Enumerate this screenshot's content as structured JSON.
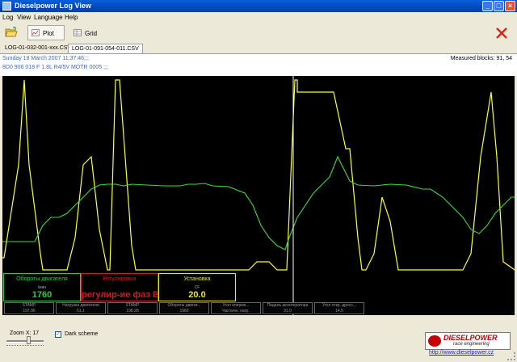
{
  "window": {
    "title": "Dieselpower Log View"
  },
  "menu": [
    "Log",
    "View",
    "Language",
    "Help"
  ],
  "toolbar": {
    "plot_label": "Plot",
    "grid_label": "Grid"
  },
  "tabs": [
    "LOG-01-032-001-xxx.CSV",
    "LOG-01-091-054-011.CSV"
  ],
  "info": {
    "date": "Sunday 18 March 2007 11:37:46;;;",
    "vehicle": "8D0 906 018 F  1.8L R4/5V MOTR    0005 ;;;",
    "measured_blocks": "Measured blocks: 91, 54"
  },
  "gauges": [
    {
      "title": "Обороты двигателя",
      "unit": "/мин",
      "value": "1760",
      "color": "#2ecc40"
    },
    {
      "title": "Регулировка",
      "unit": "",
      "value": "регулир-ие фаз ВП",
      "color": "#cc1f1f"
    },
    {
      "title": "Установка",
      "unit": "CF",
      "value": "20.0",
      "color": "#e8e820"
    }
  ],
  "mini_cells": [
    {
      "label": "STAMP",
      "value": "197.96"
    },
    {
      "label": "Нагрузка двигателя",
      "value": "51.1"
    },
    {
      "label": "STAMP",
      "value": "198.28"
    },
    {
      "label": "Обороты двигат...",
      "value": "1960"
    },
    {
      "label": "Угол опереж...",
      "value": "Частичн. нагр."
    },
    {
      "label": "Педаль акселератора",
      "value": "31.0"
    },
    {
      "label": "Угол откр. дросс...",
      "value": "14.5"
    }
  ],
  "bottom": {
    "zoom_label": "Zoom X: 17",
    "dark_scheme_label": "Dark scheme",
    "dark_scheme_checked": true,
    "logo_brand": "DIESELPOWER",
    "logo_sub": "race engineering",
    "url": "http://www.dieselpower.cz"
  },
  "colors": {
    "plot_bg": "#000000",
    "series_green": "#3ddc3d",
    "series_yellow": "#ffff33",
    "cursor": "#ffffff"
  }
}
